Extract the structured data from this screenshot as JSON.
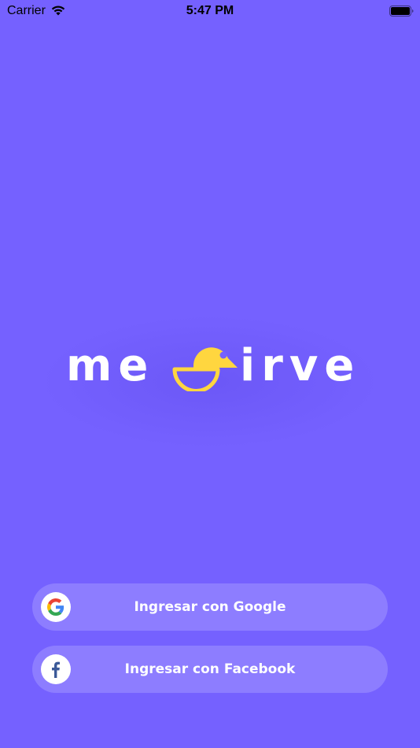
{
  "status_bar": {
    "carrier": "Carrier",
    "time": "5:47 PM",
    "wifi_icon": "wifi-icon",
    "battery_icon": "battery-icon"
  },
  "logo": {
    "part1": "me",
    "part2": "irve",
    "mark_icon": "mesirve-mark-icon",
    "mark_color": "#FFD63F"
  },
  "buttons": {
    "google_label": "Ingresar con Google",
    "google_icon": "google-icon",
    "facebook_label": "Ingresar con Facebook",
    "facebook_icon": "facebook-icon"
  },
  "colors": {
    "background": "#7561FF",
    "button_bg": "#8F7EFF",
    "text": "#FFFFFF",
    "accent": "#FFD63F",
    "facebook_blue": "#3B5998"
  }
}
